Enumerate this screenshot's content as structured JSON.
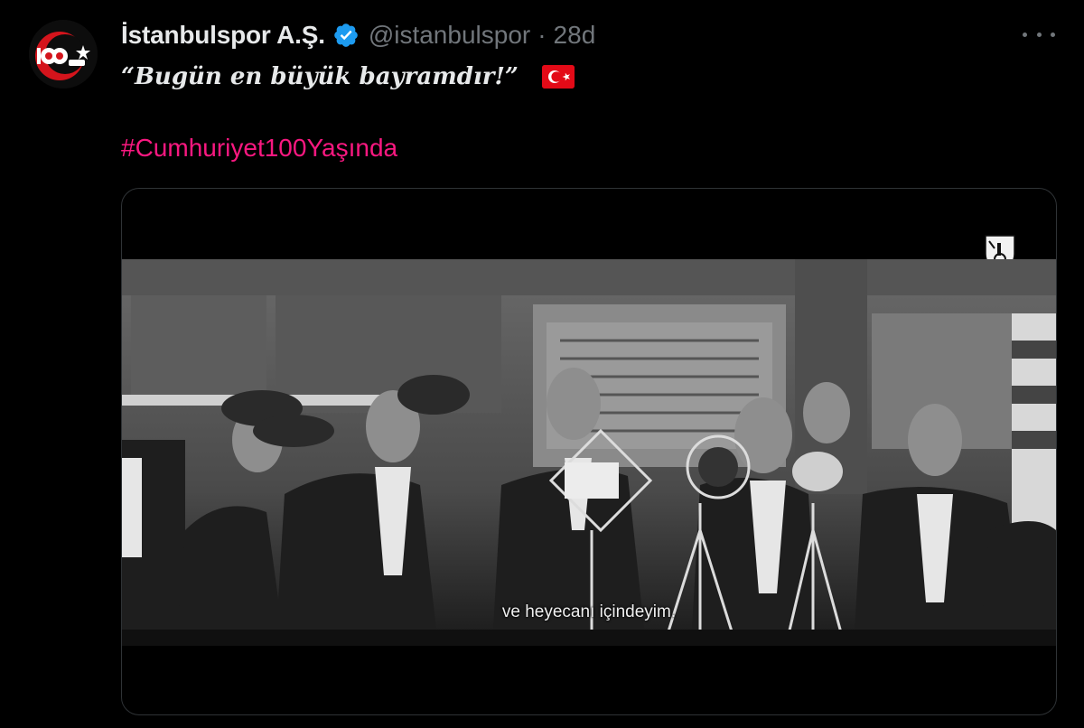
{
  "tweet": {
    "display_name": "İstanbulspor A.Ş.",
    "handle": "@istanbulspor",
    "separator": "·",
    "time": "28d",
    "text_quote": "“Bugün en büyük bayramdır!”",
    "hashtag": "#Cumhuriyet100Yaşında",
    "verified_color": "#1d9bf0",
    "hashtag_color": "#f91880"
  },
  "media": {
    "subtitle": "ve heyecanı içindeyim."
  },
  "icons": {
    "avatar": "club-logo-100-yil",
    "verified": "verified-badge-icon",
    "more": "more-options-icon",
    "flag": "turkey-flag-emoji",
    "watermark": "channel-logo-icon"
  }
}
